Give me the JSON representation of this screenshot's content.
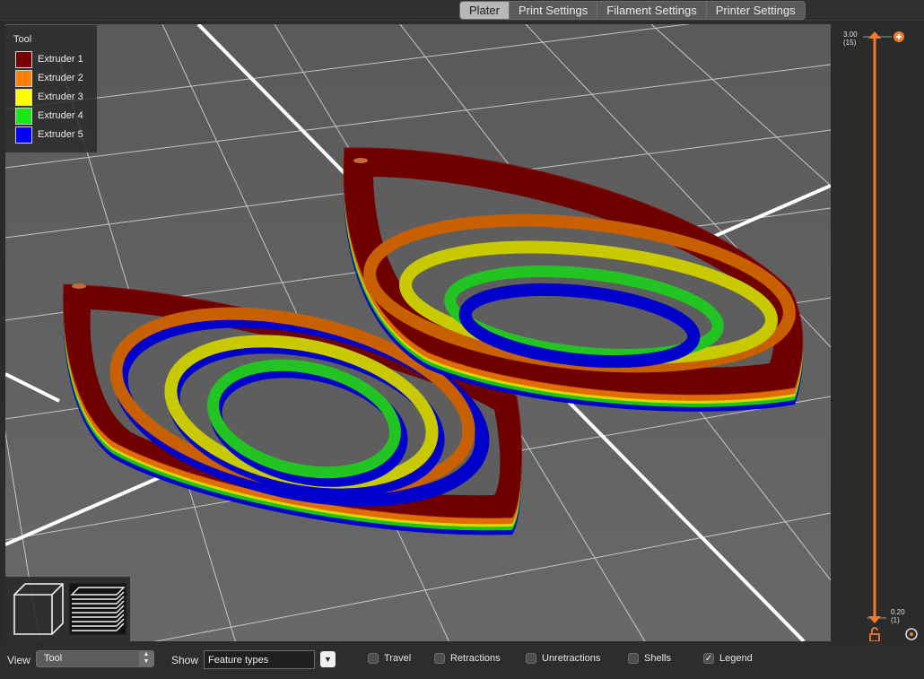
{
  "tabs": [
    {
      "label": "Plater",
      "active": true
    },
    {
      "label": "Print Settings",
      "active": false
    },
    {
      "label": "Filament Settings",
      "active": false
    },
    {
      "label": "Printer Settings",
      "active": false
    }
  ],
  "legend": {
    "title": "Tool",
    "items": [
      {
        "label": "Extruder 1",
        "color": "#7a0000"
      },
      {
        "label": "Extruder 2",
        "color": "#ff7f00"
      },
      {
        "label": "Extruder 3",
        "color": "#ffff00"
      },
      {
        "label": "Extruder 4",
        "color": "#19e619"
      },
      {
        "label": "Extruder 5",
        "color": "#0000ff"
      }
    ]
  },
  "slider": {
    "top_value": "3.00",
    "top_layer": "(15)",
    "bottom_value": "0.20",
    "bottom_layer": "(1)",
    "color": "#f07b2a"
  },
  "bottom": {
    "view_label": "View",
    "view_value": "Tool",
    "show_label": "Show",
    "show_value": "Feature types",
    "checks": [
      {
        "label": "Travel",
        "checked": false
      },
      {
        "label": "Retractions",
        "checked": false
      },
      {
        "label": "Unretractions",
        "checked": false
      },
      {
        "label": "Shells",
        "checked": false
      },
      {
        "label": "Legend",
        "checked": true
      }
    ]
  }
}
